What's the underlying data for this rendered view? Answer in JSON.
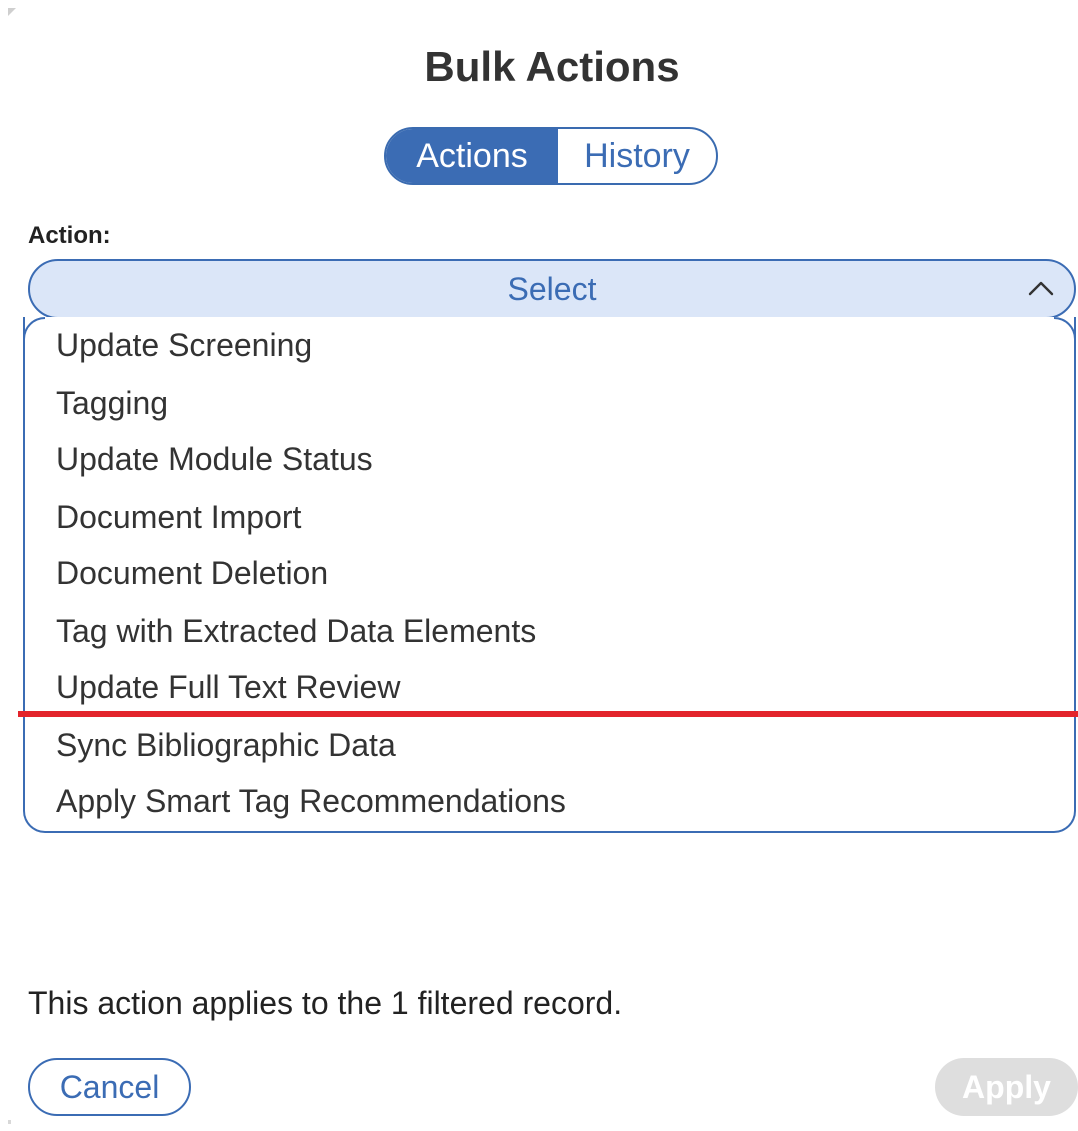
{
  "dialog": {
    "title": "Bulk Actions"
  },
  "tabs": [
    {
      "label": "Actions",
      "active": true
    },
    {
      "label": "History",
      "active": false
    }
  ],
  "action_field": {
    "label": "Action:",
    "selected_value": "Select",
    "expanded": true
  },
  "options": [
    "Update Screening",
    "Tagging",
    "Update Module Status",
    "Document Import",
    "Document Deletion",
    "Tag with Extracted Data Elements",
    "Update Full Text Review",
    "Sync Bibliographic Data",
    "Apply Smart Tag Recommendations"
  ],
  "info_text": "This action applies to the 1 filtered record.",
  "buttons": {
    "cancel": "Cancel",
    "apply": "Apply",
    "apply_enabled": false
  },
  "colors": {
    "primary": "#3b6cb4",
    "select_bg": "#dbe6f8",
    "highlight_line": "#e3242b",
    "disabled_bg": "#dedede"
  },
  "icons": {
    "dropdown_indicator": "chevron-up-icon"
  }
}
